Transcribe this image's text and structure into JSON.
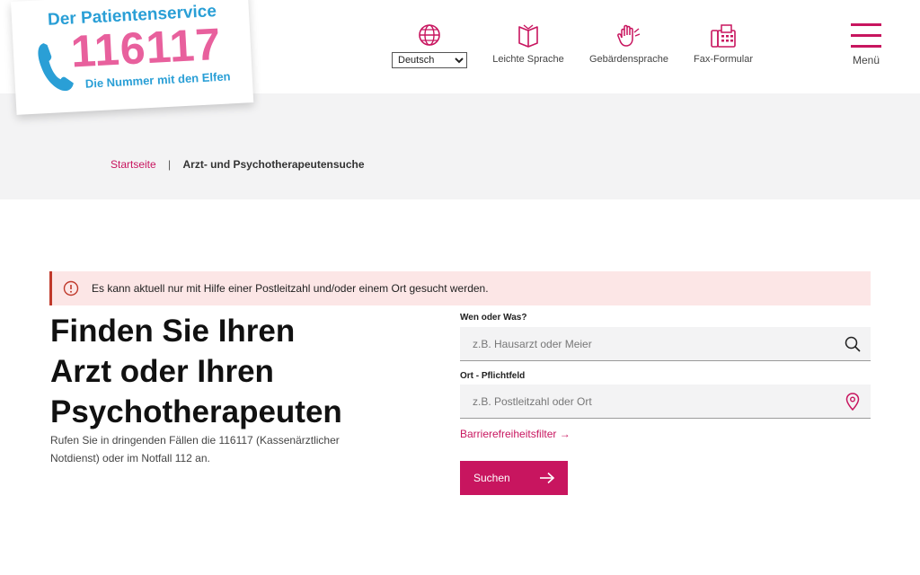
{
  "logo": {
    "title": "Der Patientenservice",
    "number": "116117",
    "subtitle": "Die Nummer mit den Elfen"
  },
  "header": {
    "language": {
      "selected": "Deutsch",
      "options": [
        "Deutsch"
      ]
    },
    "tools": [
      {
        "label": "Leichte Sprache",
        "icon": "book-icon"
      },
      {
        "label": "Gebärdensprache",
        "icon": "sign-language-icon"
      },
      {
        "label": "Fax-Formular",
        "icon": "fax-icon"
      }
    ],
    "menu_label": "Menü"
  },
  "breadcrumb": {
    "home": "Startseite",
    "separator": "|",
    "current": "Arzt- und Psychotherapeutensuche"
  },
  "alert": {
    "text": "Es kann aktuell nur mit Hilfe einer Postleitzahl und/oder einem Ort gesucht werden."
  },
  "main": {
    "headline_lines": [
      "Finden Sie Ihren",
      "Arzt oder Ihren",
      "Psychotherapeuten"
    ],
    "subtext": "Rufen Sie in dringenden Fällen die 116117 (Kassenärztlicher Notdienst) oder im Notfall 112 an."
  },
  "form": {
    "who_label": "Wen oder Was?",
    "who_placeholder": "z.B. Hausarzt oder Meier",
    "who_value": "",
    "where_label": "Ort - Pflichtfeld",
    "where_placeholder": "z.B. Postleitzahl oder Ort",
    "where_value": "",
    "filter_link": "Barrierefreiheitsfilter →",
    "submit_label": "Suchen"
  },
  "colors": {
    "accent": "#c8155f",
    "logo_blue": "#2a9fd6",
    "logo_pink": "#e8609d",
    "alert_bg": "#fce6e6",
    "band_bg": "#f3f3f4"
  }
}
